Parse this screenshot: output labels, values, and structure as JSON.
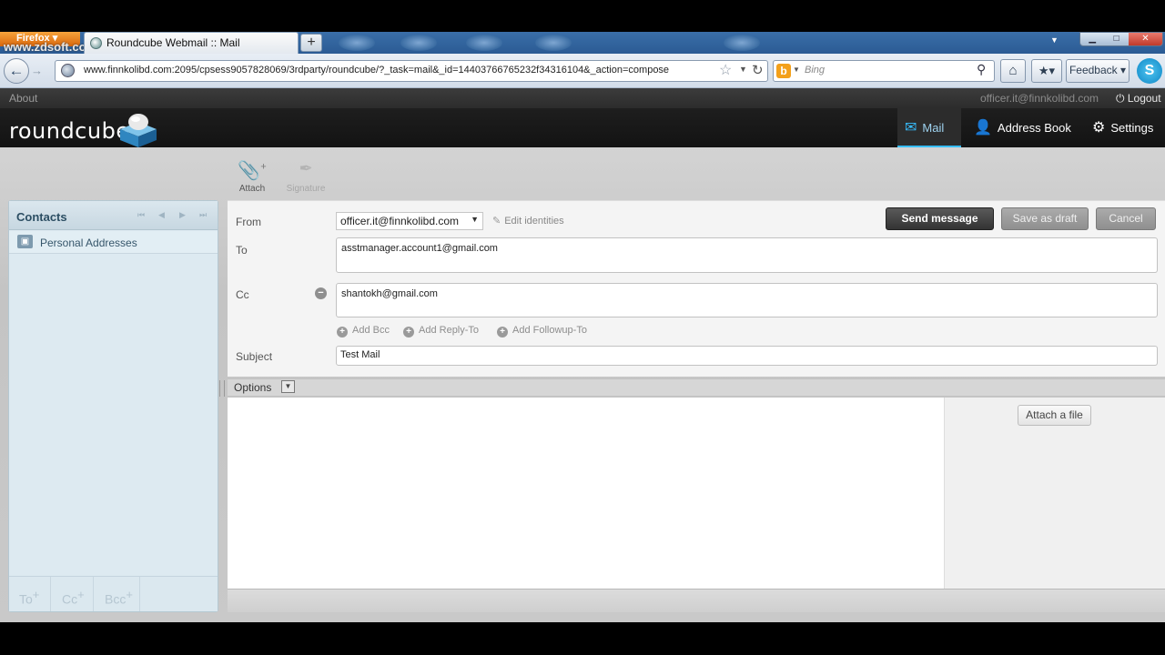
{
  "browser": {
    "app_button": "Firefox",
    "watermark": "www.zdsoft.com",
    "tab_title": "Roundcube Webmail :: Mail",
    "new_tab": "+",
    "url": "www.finnkolibd.com:2095/cpsess9057828069/3rdparty/roundcube/?_task=mail&_id=14403766765232f34316104&_action=compose",
    "search_placeholder": "Bing",
    "feedback_label": "Feedback",
    "feedback_arrow": "▾"
  },
  "rc": {
    "about": "About",
    "user_email": "officer.it@finnkolibd.com",
    "logout": "Logout",
    "logo_text": "roundcube",
    "nav": {
      "mail": "Mail",
      "address_book": "Address Book",
      "settings": "Settings"
    },
    "toolbar": {
      "attach": "Attach",
      "signature": "Signature"
    },
    "contacts": {
      "title": "Contacts",
      "addressbook": "Personal Addresses",
      "footer": [
        "To",
        "Cc",
        "Bcc"
      ]
    },
    "compose": {
      "from_label": "From",
      "from_value": "officer.it@finnkolibd.com",
      "edit_identities": "Edit identities",
      "to_label": "To",
      "to_value": "asstmanager.account1@gmail.com",
      "cc_label": "Cc",
      "cc_value": "shantokh@gmail.com",
      "add_bcc": "Add Bcc",
      "add_reply_to": "Add Reply-To",
      "add_followup_to": "Add Followup-To",
      "subject_label": "Subject",
      "subject_value": "Test Mail",
      "send": "Send message",
      "save_draft": "Save as draft",
      "cancel": "Cancel",
      "options": "Options",
      "attach_file": "Attach a file"
    }
  },
  "colors": {
    "accent": "#37beff",
    "header_bg": "#1a1a1a",
    "contacts_bg": "#ddeaf1"
  }
}
